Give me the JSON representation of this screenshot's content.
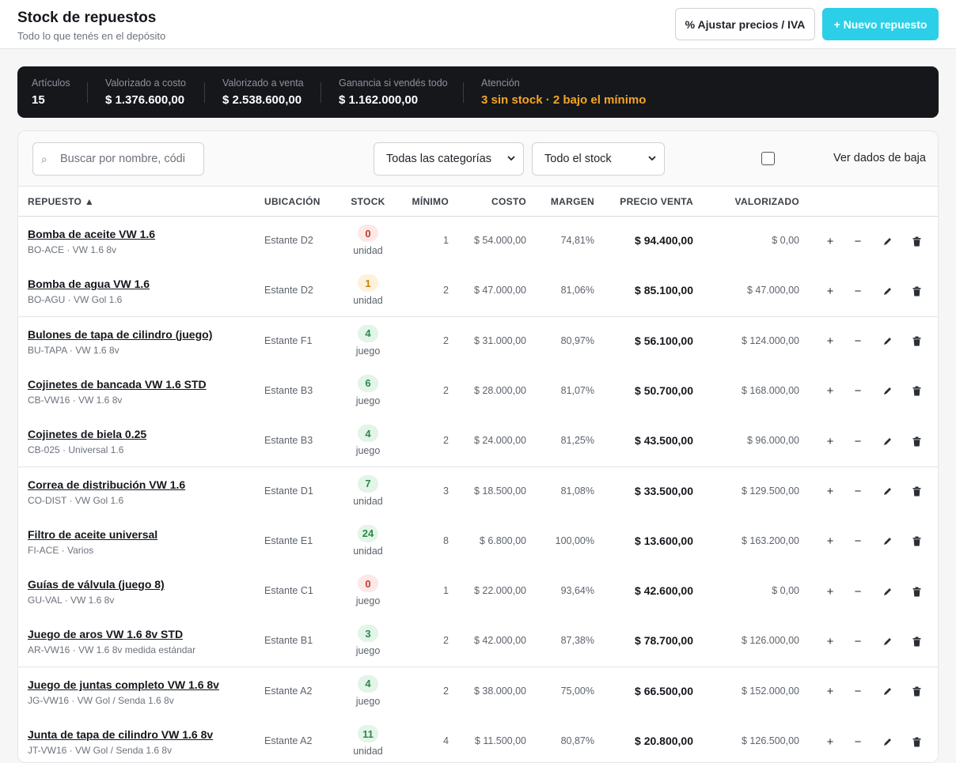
{
  "header": {
    "title": "Stock de repuestos",
    "subtitle": "Todo lo que tenés en el depósito",
    "adjust_button": "% Ajustar precios / IVA",
    "new_button": "+ Nuevo repuesto"
  },
  "summary": {
    "articles_label": "Artículos",
    "articles_value": "15",
    "cost_label": "Valorizado a costo",
    "cost_value": "$ 1.376.600,00",
    "sale_label": "Valorizado a venta",
    "sale_value": "$ 2.538.600,00",
    "profit_label": "Ganancia si vendés todo",
    "profit_value": "$ 1.162.000,00",
    "attention_label": "Atención",
    "attention_value": "3 sin stock · 2 bajo el mínimo"
  },
  "filters": {
    "search_placeholder": "Buscar por nombre, códi",
    "category_selected": "Todas las categorías",
    "stock_selected": "Todo el stock",
    "show_deleted_label": "Ver dados de baja"
  },
  "table": {
    "headers": {
      "part": "REPUESTO ▲",
      "location": "UBICACIÓN",
      "stock": "STOCK",
      "min": "MÍNIMO",
      "cost": "COSTO",
      "margin": "MARGEN",
      "price": "PRECIO VENTA",
      "valued": "VALORIZADO"
    },
    "actions": {
      "plus": "+",
      "minus": "−"
    },
    "rows": [
      {
        "name": "Bomba de aceite VW 1.6",
        "code": "BO-ACE · VW 1.6 8v",
        "location": "Estante D2",
        "stock": "0",
        "stock_level": "red",
        "unit": "unidad",
        "min": "1",
        "cost": "$ 54.000,00",
        "margin": "74,81%",
        "price": "$ 94.400,00",
        "valued": "$ 0,00"
      },
      {
        "name": "Bomba de agua VW 1.6",
        "code": "BO-AGU · VW Gol 1.6",
        "location": "Estante D2",
        "stock": "1",
        "stock_level": "amber",
        "unit": "unidad",
        "min": "2",
        "cost": "$ 47.000,00",
        "margin": "81,06%",
        "price": "$ 85.100,00",
        "valued": "$ 47.000,00"
      },
      {
        "name": "Bulones de tapa de cilindro (juego)",
        "code": "BU-TAPA · VW 1.6 8v",
        "location": "Estante F1",
        "stock": "4",
        "stock_level": "green",
        "unit": "juego",
        "min": "2",
        "cost": "$ 31.000,00",
        "margin": "80,97%",
        "price": "$ 56.100,00",
        "valued": "$ 124.000,00"
      },
      {
        "name": "Cojinetes de bancada VW 1.6 STD",
        "code": "CB-VW16 · VW 1.6 8v",
        "location": "Estante B3",
        "stock": "6",
        "stock_level": "green",
        "unit": "juego",
        "min": "2",
        "cost": "$ 28.000,00",
        "margin": "81,07%",
        "price": "$ 50.700,00",
        "valued": "$ 168.000,00"
      },
      {
        "name": "Cojinetes de biela 0.25",
        "code": "CB-025 · Universal 1.6",
        "location": "Estante B3",
        "stock": "4",
        "stock_level": "green",
        "unit": "juego",
        "min": "2",
        "cost": "$ 24.000,00",
        "margin": "81,25%",
        "price": "$ 43.500,00",
        "valued": "$ 96.000,00"
      },
      {
        "name": "Correa de distribución VW 1.6",
        "code": "CO-DIST · VW Gol 1.6",
        "location": "Estante D1",
        "stock": "7",
        "stock_level": "green",
        "unit": "unidad",
        "min": "3",
        "cost": "$ 18.500,00",
        "margin": "81,08%",
        "price": "$ 33.500,00",
        "valued": "$ 129.500,00"
      },
      {
        "name": "Filtro de aceite universal",
        "code": "FI-ACE · Varios",
        "location": "Estante E1",
        "stock": "24",
        "stock_level": "green",
        "unit": "unidad",
        "min": "8",
        "cost": "$ 6.800,00",
        "margin": "100,00%",
        "price": "$ 13.600,00",
        "valued": "$ 163.200,00"
      },
      {
        "name": "Guías de válvula (juego 8)",
        "code": "GU-VAL · VW 1.6 8v",
        "location": "Estante C1",
        "stock": "0",
        "stock_level": "red",
        "unit": "juego",
        "min": "1",
        "cost": "$ 22.000,00",
        "margin": "93,64%",
        "price": "$ 42.600,00",
        "valued": "$ 0,00"
      },
      {
        "name": "Juego de aros VW 1.6 8v STD",
        "code": "AR-VW16 · VW 1.6 8v medida estándar",
        "location": "Estante B1",
        "stock": "3",
        "stock_level": "green",
        "unit": "juego",
        "min": "2",
        "cost": "$ 42.000,00",
        "margin": "87,38%",
        "price": "$ 78.700,00",
        "valued": "$ 126.000,00"
      },
      {
        "name": "Juego de juntas completo VW 1.6 8v",
        "code": "JG-VW16 · VW Gol / Senda 1.6 8v",
        "location": "Estante A2",
        "stock": "4",
        "stock_level": "green",
        "unit": "juego",
        "min": "2",
        "cost": "$ 38.000,00",
        "margin": "75,00%",
        "price": "$ 66.500,00",
        "valued": "$ 152.000,00"
      },
      {
        "name": "Junta de tapa de cilindro VW 1.6 8v",
        "code": "JT-VW16 · VW Gol / Senda 1.6 8v",
        "location": "Estante A2",
        "stock": "11",
        "stock_level": "green",
        "unit": "unidad",
        "min": "4",
        "cost": "$ 11.500,00",
        "margin": "80,87%",
        "price": "$ 20.800,00",
        "valued": "$ 126.500,00"
      }
    ]
  }
}
